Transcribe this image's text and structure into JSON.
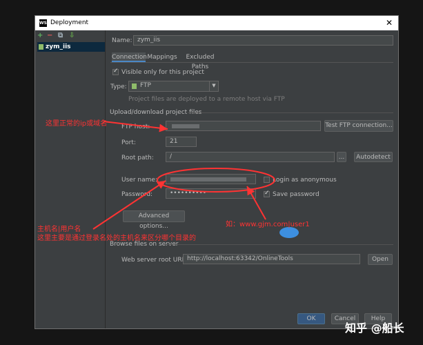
{
  "window": {
    "title": "Deployment",
    "close": "✕"
  },
  "toolbar": {
    "add": "+",
    "remove": "−",
    "copy": "⧉",
    "export": "⇩"
  },
  "tree": {
    "selected": "zym_iis"
  },
  "form": {
    "name_label": "Name:",
    "name_value": "zym_iis",
    "tabs": [
      "Connection",
      "Mappings",
      "Excluded Paths"
    ],
    "visible_only": "Visible only for this project",
    "type_label": "Type:",
    "type_value": "FTP",
    "type_hint": "Project files are deployed to a remote host via FTP",
    "section_upload": "Upload/download project files",
    "ftp_host_label": "FTP host:",
    "test_ftp_button": "Test FTP connection...",
    "port_label": "Port:",
    "port_value": "21",
    "root_path_label": "Root path:",
    "root_path_value": "/",
    "browse_button": "...",
    "autodetect_button": "Autodetect",
    "user_name_label": "User name:",
    "login_anon": "Login as anonymous",
    "password_label": "Password:",
    "password_value": "••••••••••",
    "save_password": "Save password",
    "advanced_button": "Advanced options...",
    "section_browse": "Browse files on server",
    "web_root_label": "Web server root URL:",
    "web_root_value": "http://localhost:63342/OnlineTools",
    "open_button": "Open",
    "ok_button": "OK",
    "cancel_button": "Cancel",
    "help_button": "Help"
  },
  "annotations": {
    "host_note": "这里正常的ip或域名",
    "user_note_line1": "主机名|用户名",
    "user_note_line2": "这里主要是通过登录名处的主机名来区分哪个目录的",
    "example_note": "如：www.gjm.com|user1"
  },
  "watermark": "知乎 @船长",
  "colors": {
    "accent": "#4a88c7",
    "annotation": "#ff3333",
    "dialog_bg": "#3c3f41"
  }
}
